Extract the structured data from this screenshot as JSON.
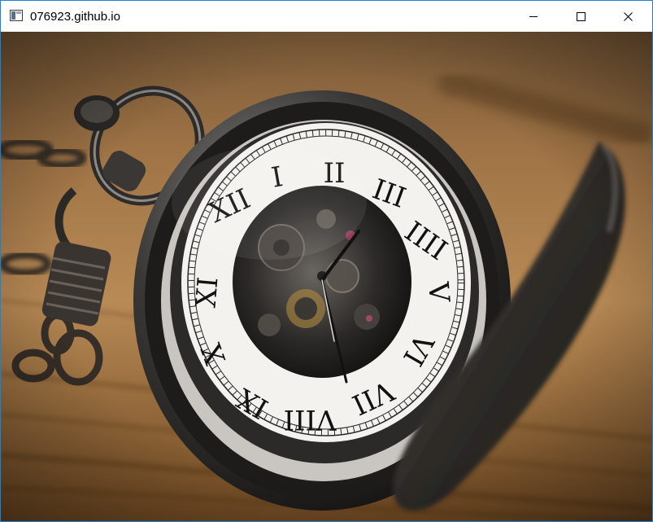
{
  "window": {
    "title": "076923.github.io",
    "accent_color": "#1883d7"
  },
  "controls": {
    "minimize_icon": "minimize-icon",
    "maximize_icon": "maximize-icon",
    "close_icon": "close-icon"
  },
  "content": {
    "image_subject": "pocket-watch",
    "dial_numerals": [
      "I",
      "II",
      "III",
      "IIII",
      "V",
      "VI",
      "VII",
      "VIII",
      "IX",
      "X",
      "XI",
      "XII"
    ],
    "colors": {
      "wood_light": "#b88a55",
      "wood_dark": "#4a3016",
      "dial_white": "#f4f2ee",
      "case_dark": "#2a2826"
    }
  }
}
